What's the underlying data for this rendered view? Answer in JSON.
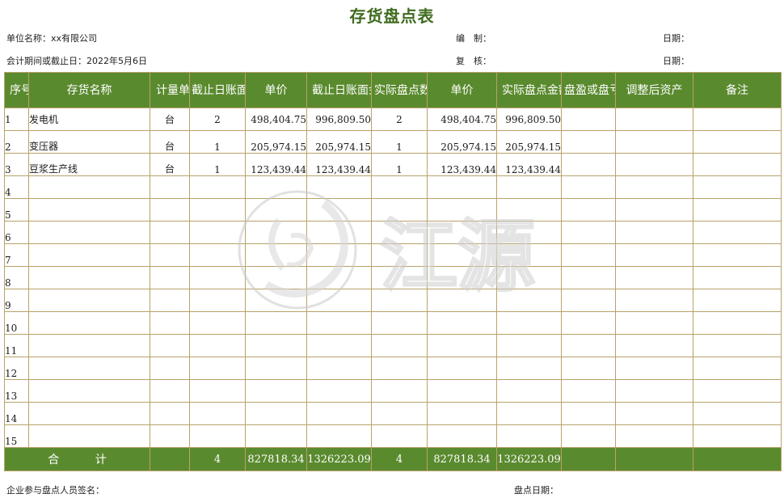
{
  "document": {
    "title": "存货盘点表",
    "unit_name": "单位名称：xx有限公司",
    "compiler": "编　制：",
    "date1": "日期：",
    "period": "会计期间或截止日：2022年5月6日",
    "reviewer": "复　核：",
    "date2": "日期：",
    "signers": "企业参与盘点人员签名：",
    "count_date": "盘点日期："
  },
  "table": {
    "headers": {
      "no": "序号",
      "name": "存货名称",
      "unit": "计量单位",
      "book_qty": "截止日账面",
      "price1": "单价",
      "book_amount": "截止日账面金额",
      "actual_qty": "实际盘点数量",
      "price2": "单价",
      "actual_amount": "实际盘点金额",
      "diff": "盘盈或盘亏金额",
      "adjusted": "调整后资产",
      "remark": "备注"
    },
    "rows": [
      {
        "no": "1",
        "name": "发电机",
        "unit": "台",
        "book_qty": "2",
        "price1": "498,404.75",
        "book_amount": "996,809.50",
        "actual_qty": "2",
        "price2": "498,404.75",
        "actual_amount": "996,809.50"
      },
      {
        "no": "2",
        "name": "变压器",
        "unit": "台",
        "book_qty": "1",
        "price1": "205,974.15",
        "book_amount": "205,974.15",
        "actual_qty": "1",
        "price2": "205,974.15",
        "actual_amount": "205,974.15"
      },
      {
        "no": "3",
        "name": "豆浆生产线",
        "unit": "台",
        "book_qty": "1",
        "price1": "123,439.44",
        "book_amount": "123,439.44",
        "actual_qty": "1",
        "price2": "123,439.44",
        "actual_amount": "123,439.44"
      },
      {
        "no": "4"
      },
      {
        "no": "5"
      },
      {
        "no": "6"
      },
      {
        "no": "7"
      },
      {
        "no": "8"
      },
      {
        "no": "9"
      },
      {
        "no": "10"
      },
      {
        "no": "11"
      },
      {
        "no": "12"
      },
      {
        "no": "13"
      },
      {
        "no": "14"
      },
      {
        "no": "15"
      }
    ],
    "total": {
      "label": "合 计",
      "book_qty": "4",
      "price1": "827818.34",
      "book_amount": "1326223.09",
      "actual_qty": "4",
      "price2": "827818.34",
      "actual_amount": "1326223.09"
    }
  },
  "watermark": {
    "text": "江源",
    "icon": "brand-logo-icon"
  },
  "colors": {
    "header_green": "#5a8a2e",
    "title_green": "#3f6b1f",
    "grid": "#b9a26a"
  }
}
